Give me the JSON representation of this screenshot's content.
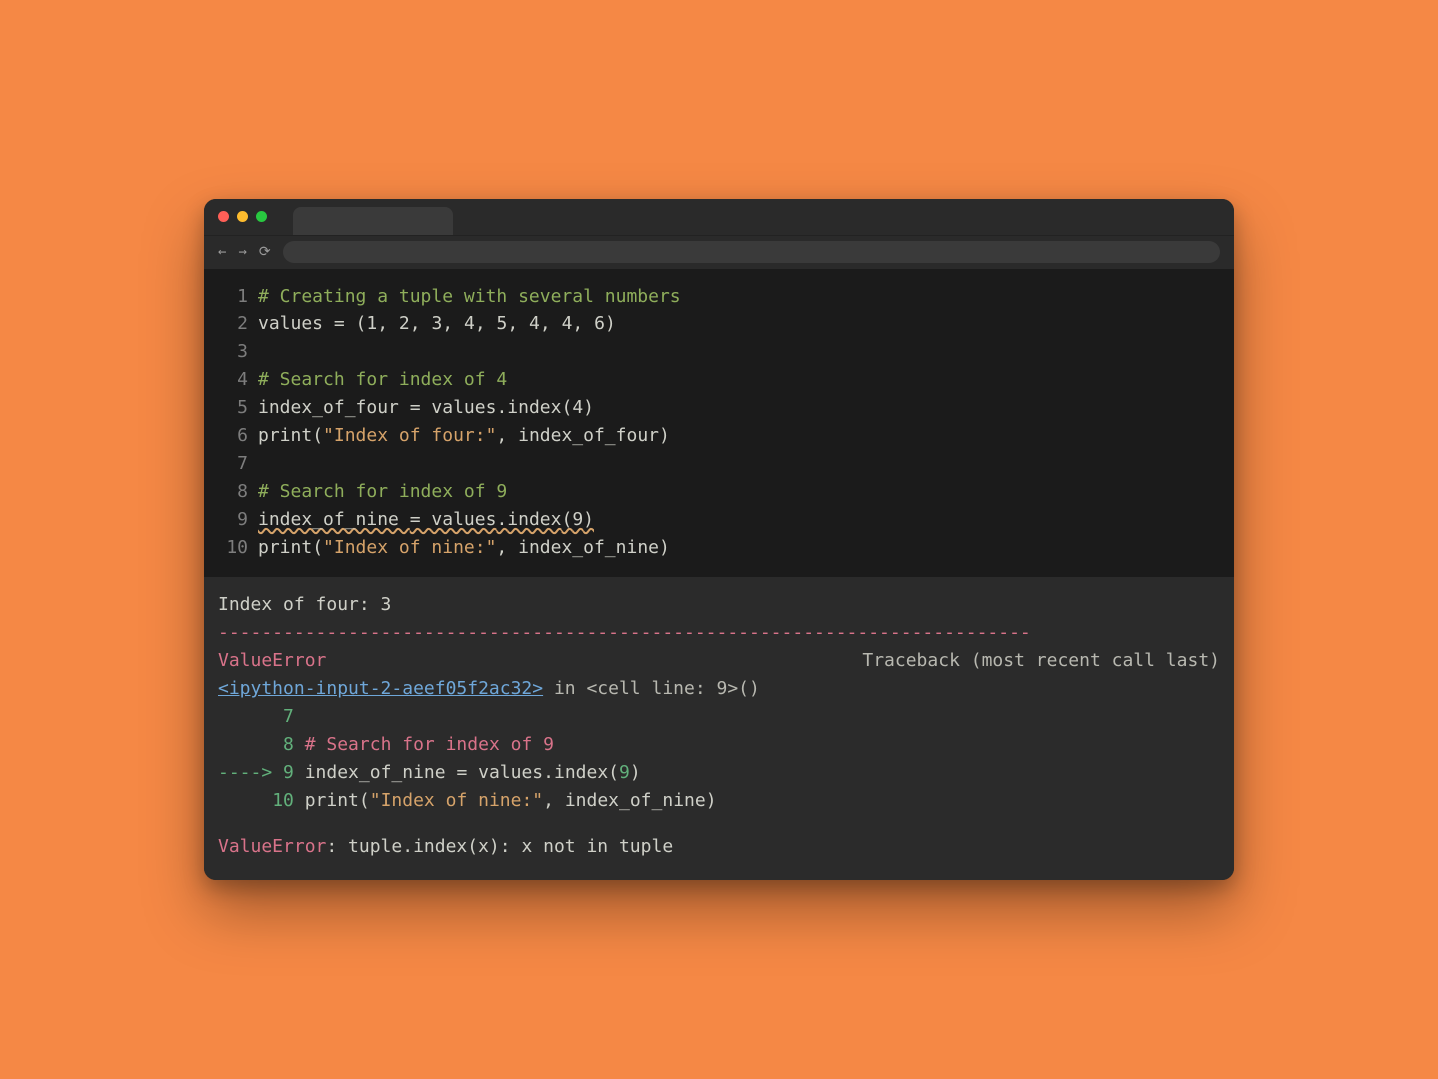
{
  "traffic_lights": {
    "close": "#ff5f57",
    "min": "#febc2e",
    "max": "#28c840"
  },
  "nav": {
    "back": "←",
    "forward": "→",
    "reload": "⟳"
  },
  "code": {
    "lines": [
      {
        "n": "1",
        "segs": [
          [
            "comment",
            "# Creating a tuple with several numbers"
          ]
        ]
      },
      {
        "n": "2",
        "segs": [
          [
            "ident",
            "values "
          ],
          [
            "op",
            "= ("
          ],
          [
            "num",
            "1"
          ],
          [
            "op",
            ", "
          ],
          [
            "num",
            "2"
          ],
          [
            "op",
            ", "
          ],
          [
            "num",
            "3"
          ],
          [
            "op",
            ", "
          ],
          [
            "num",
            "4"
          ],
          [
            "op",
            ", "
          ],
          [
            "num",
            "5"
          ],
          [
            "op",
            ", "
          ],
          [
            "num",
            "4"
          ],
          [
            "op",
            ", "
          ],
          [
            "num",
            "4"
          ],
          [
            "op",
            ", "
          ],
          [
            "num",
            "6"
          ],
          [
            "op",
            ")"
          ]
        ]
      },
      {
        "n": "3",
        "segs": []
      },
      {
        "n": "4",
        "segs": [
          [
            "comment",
            "# Search for index of 4"
          ]
        ]
      },
      {
        "n": "5",
        "segs": [
          [
            "ident",
            "index_of_four "
          ],
          [
            "op",
            "= "
          ],
          [
            "ident",
            "values"
          ],
          [
            "op",
            "."
          ],
          [
            "func",
            "index"
          ],
          [
            "op",
            "("
          ],
          [
            "num",
            "4"
          ],
          [
            "op",
            ")"
          ]
        ]
      },
      {
        "n": "6",
        "segs": [
          [
            "func",
            "print"
          ],
          [
            "op",
            "("
          ],
          [
            "str",
            "\"Index of four:\""
          ],
          [
            "op",
            ", "
          ],
          [
            "ident",
            "index_of_four"
          ],
          [
            "op",
            ")"
          ]
        ]
      },
      {
        "n": "7",
        "segs": []
      },
      {
        "n": "8",
        "segs": [
          [
            "comment",
            "# Search for index of 9"
          ]
        ]
      },
      {
        "n": "9",
        "squiggle": true,
        "segs": [
          [
            "ident",
            "index_of_nine "
          ],
          [
            "op",
            "= "
          ],
          [
            "ident",
            "values"
          ],
          [
            "op",
            "."
          ],
          [
            "func",
            "index"
          ],
          [
            "op",
            "("
          ],
          [
            "num",
            "9"
          ],
          [
            "op",
            ")"
          ]
        ]
      },
      {
        "n": "10",
        "segs": [
          [
            "func",
            "print"
          ],
          [
            "op",
            "("
          ],
          [
            "str",
            "\"Index of nine:\""
          ],
          [
            "op",
            ", "
          ],
          [
            "ident",
            "index_of_nine"
          ],
          [
            "op",
            ")"
          ]
        ]
      }
    ]
  },
  "output": {
    "plain_result": "Index of four: 3",
    "dash_line": "---------------------------------------------------------------------------",
    "err_header_left": "ValueError",
    "err_header_right": "Traceback (most recent call last)",
    "link": "<ipython-input-2-aeef05f2ac32>",
    "link_suffix": " in <cell line: 9>()",
    "tb": [
      {
        "prefix": "      ",
        "lineno": "7",
        "segs": []
      },
      {
        "prefix": "      ",
        "lineno": "8",
        "segs": [
          [
            "comment",
            " # Search for index of 9"
          ]
        ]
      },
      {
        "prefix": "----> ",
        "lineno": "9",
        "segs": [
          [
            "code",
            " index_of_nine "
          ],
          [
            "op",
            "="
          ],
          [
            "code",
            " values"
          ],
          [
            "op",
            "."
          ],
          [
            "code",
            "index"
          ],
          [
            "op",
            "("
          ],
          [
            "num",
            "9"
          ],
          [
            "op",
            ")"
          ]
        ]
      },
      {
        "prefix": "     ",
        "lineno": "10",
        "segs": [
          [
            "code",
            " print"
          ],
          [
            "op",
            "("
          ],
          [
            "str",
            "\"Index of nine:\""
          ],
          [
            "op",
            ", "
          ],
          [
            "code",
            "index_of_nine"
          ],
          [
            "op",
            ")"
          ]
        ]
      }
    ],
    "final_err_name": "ValueError",
    "final_err_msg": ": tuple.index(x): x not in tuple"
  }
}
